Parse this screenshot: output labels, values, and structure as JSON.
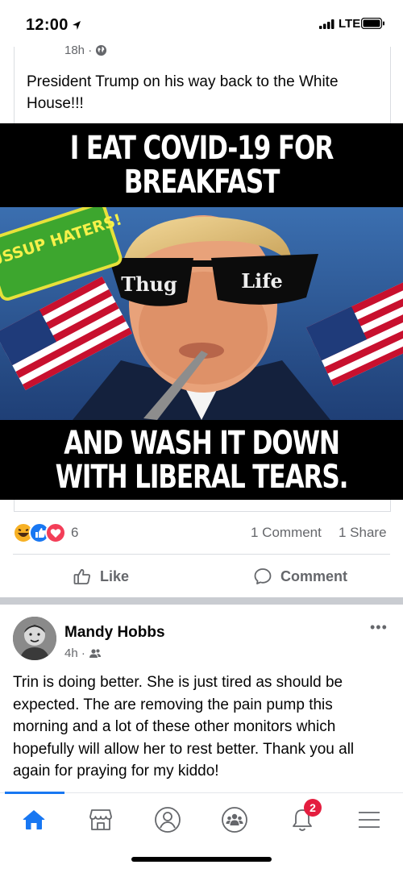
{
  "status_bar": {
    "time": "12:00",
    "network": "LTE"
  },
  "shared_post": {
    "time": "18h",
    "text": "President Trump on his way back to the White House!!!",
    "meme": {
      "top_caption": "I EAT COVID-19 FOR BREAKFAST",
      "bottom_caption": "AND WASH IT DOWN WITH LIBERAL TEARS.",
      "sign_text": "WUSSUP HATERS!",
      "glasses_left": "Thug",
      "glasses_right": "Life"
    },
    "reaction_count": "6",
    "comments": "1 Comment",
    "shares": "1 Share",
    "like_label": "Like",
    "comment_label": "Comment"
  },
  "post": {
    "author": "Mandy Hobbs",
    "time": "4h",
    "more": "•••",
    "text": "Trin is doing better.  She is just tired as should be expected. The are removing the pain pump this morning and a lot of these other monitors which hopefully will allow her to rest better.  Thank you all again for praying for my kiddo!"
  },
  "nav": {
    "notifications_badge": "2",
    "items": [
      "home-icon",
      "marketplace-icon",
      "profile-icon",
      "groups-icon",
      "notifications-icon",
      "menu-icon"
    ]
  },
  "colors": {
    "accent": "#1877f2",
    "badge": "#e41e3f",
    "secondary_text": "#65676b"
  }
}
